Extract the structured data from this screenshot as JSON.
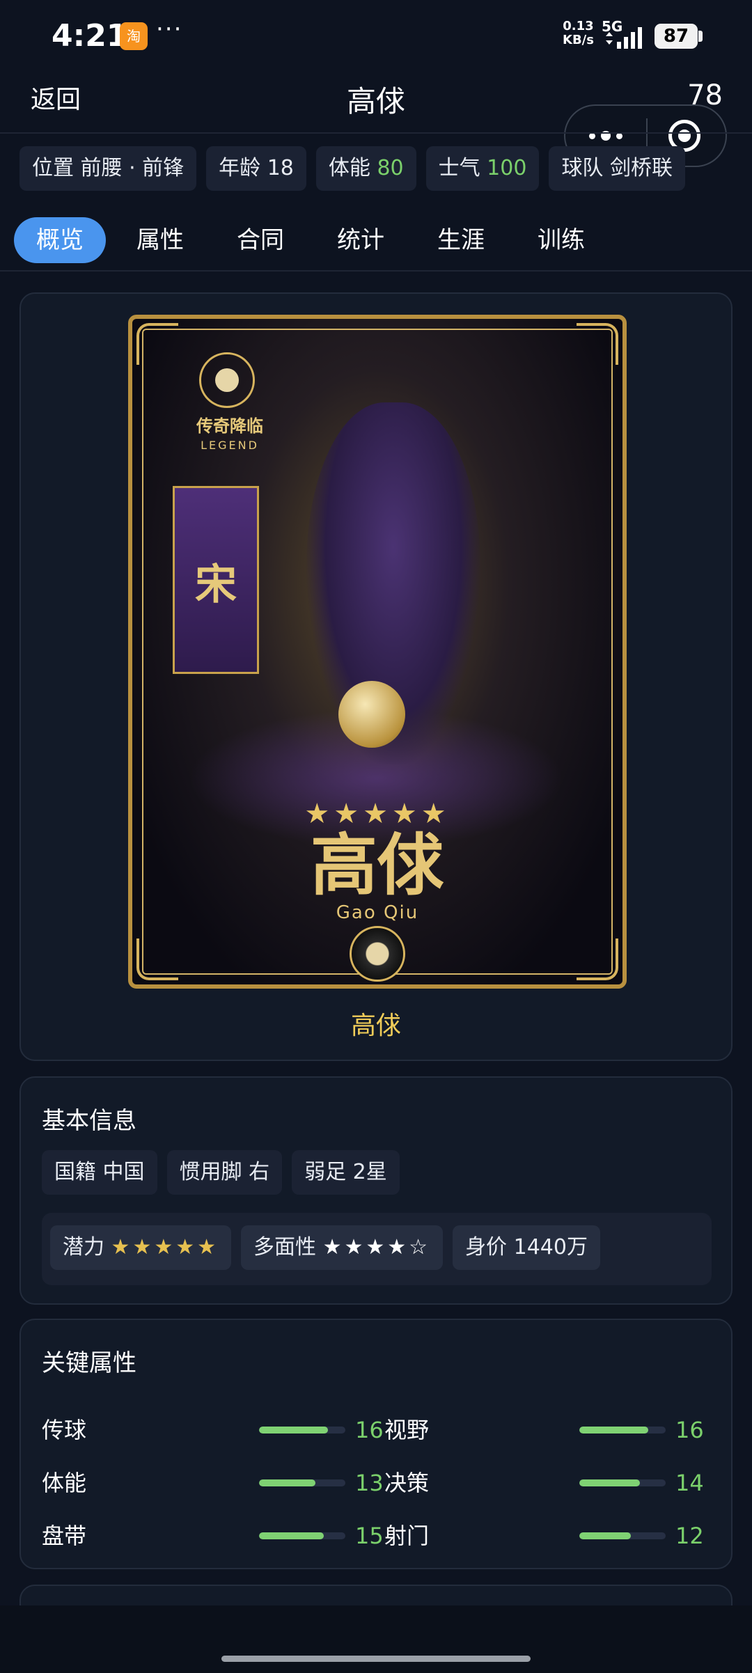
{
  "status_bar": {
    "time": "4:21",
    "app_badge": "淘",
    "dots": "···",
    "net_speed_value": "0.13",
    "net_speed_unit": "KB/s",
    "network": "5G",
    "battery": "87"
  },
  "header": {
    "back_label": "返回",
    "title": "高俅",
    "rating": "78"
  },
  "chips": [
    {
      "label": "位置",
      "value": "前腰 · 前锋"
    },
    {
      "label": "年龄",
      "value": "18"
    },
    {
      "label": "体能",
      "value": "80"
    },
    {
      "label": "士气",
      "value": "100"
    },
    {
      "label": "球队",
      "value": "剑桥联"
    }
  ],
  "tabs": [
    {
      "label": "概览",
      "active": true
    },
    {
      "label": "属性"
    },
    {
      "label": "合同"
    },
    {
      "label": "统计"
    },
    {
      "label": "生涯"
    },
    {
      "label": "训练"
    }
  ],
  "player_card": {
    "legend_cn": "传奇降临",
    "legend_en": "LEGEND",
    "banner_char": "宋",
    "stars": "★★★★★",
    "name_cn": "高俅",
    "name_en": "Gao Qiu",
    "caption": "高俅"
  },
  "basic_info": {
    "title": "基本信息",
    "tags": [
      {
        "label": "国籍",
        "value": "中国"
      },
      {
        "label": "惯用脚",
        "value": "右"
      },
      {
        "label": "弱足",
        "value": "2星"
      }
    ],
    "potential": {
      "label": "潜力",
      "stars": "★★★★★",
      "rating": 5
    },
    "versatility": {
      "label": "多面性",
      "stars": "★★★★☆",
      "rating": 4
    },
    "value": {
      "label": "身价",
      "value": "1440万"
    }
  },
  "key_attributes": {
    "title": "关键属性",
    "max": 20,
    "items": [
      {
        "name": "传球",
        "value": 16
      },
      {
        "name": "视野",
        "value": 16
      },
      {
        "name": "体能",
        "value": 13
      },
      {
        "name": "决策",
        "value": 14
      },
      {
        "name": "盘带",
        "value": 15
      },
      {
        "name": "射门",
        "value": 12
      }
    ]
  },
  "colors": {
    "background": "#0d1320",
    "card": "#121a28",
    "chip": "#1b2233",
    "accent_tab": "#4a95ee",
    "green_value": "#7bd06b",
    "gold_caption": "#f1cd59"
  }
}
